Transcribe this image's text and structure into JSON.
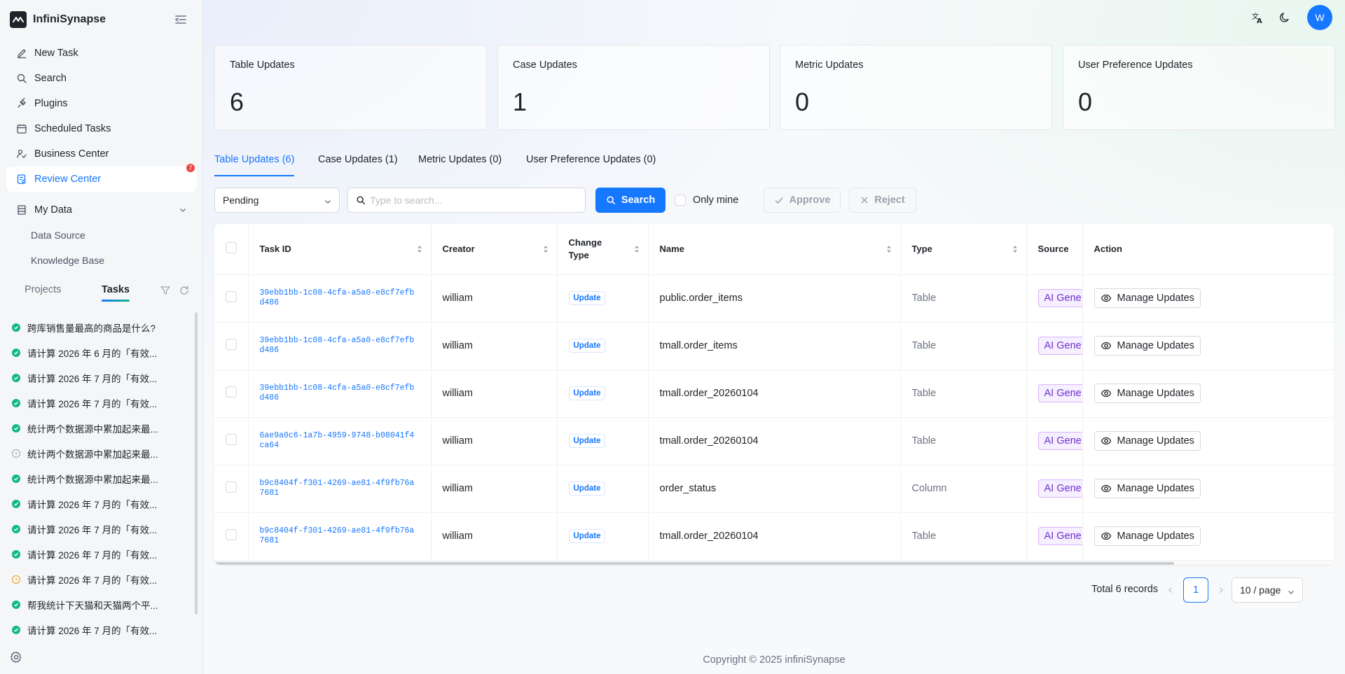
{
  "brand": {
    "name": "InfiniSynapse"
  },
  "nav": {
    "items": [
      {
        "label": "New Task",
        "icon": "edit-icon"
      },
      {
        "label": "Search",
        "icon": "search-icon"
      },
      {
        "label": "Plugins",
        "icon": "plug-icon"
      },
      {
        "label": "Scheduled Tasks",
        "icon": "calendar-icon"
      },
      {
        "label": "Business Center",
        "icon": "business-icon"
      },
      {
        "label": "Review Center",
        "icon": "review-icon",
        "active": true,
        "badge": "7"
      }
    ],
    "my_data": {
      "label": "My Data",
      "children": [
        "Data Source",
        "Knowledge Base"
      ]
    }
  },
  "side_tabs": {
    "projects": "Projects",
    "tasks": "Tasks"
  },
  "tasks": [
    {
      "title": "跨库销售量最高的商品是什么?",
      "status": "ok"
    },
    {
      "title": "请计算 2026 年 6 月的「有效...",
      "status": "ok"
    },
    {
      "title": "请计算 2026 年 7 月的「有效...",
      "status": "ok"
    },
    {
      "title": "请计算 2026 年 7 月的「有效...",
      "status": "ok"
    },
    {
      "title": "统计两个数据源中累加起来最...",
      "status": "ok"
    },
    {
      "title": "统计两个数据源中累加起来最...",
      "status": "pending"
    },
    {
      "title": "统计两个数据源中累加起来最...",
      "status": "ok"
    },
    {
      "title": "请计算 2026 年 7 月的「有效...",
      "status": "ok"
    },
    {
      "title": "请计算 2026 年 7 月的「有效...",
      "status": "ok"
    },
    {
      "title": "请计算 2026 年 7 月的「有效...",
      "status": "ok"
    },
    {
      "title": "请计算 2026 年 7 月的「有效...",
      "status": "warn"
    },
    {
      "title": "帮我统计下天猫和天猫两个平...",
      "status": "ok"
    },
    {
      "title": "请计算 2026 年 7 月的「有效...",
      "status": "ok"
    }
  ],
  "user": {
    "avatar_initial": "W"
  },
  "stats": [
    {
      "label": "Table Updates",
      "value": "6"
    },
    {
      "label": "Case Updates",
      "value": "1"
    },
    {
      "label": "Metric Updates",
      "value": "0"
    },
    {
      "label": "User Preference Updates",
      "value": "0"
    }
  ],
  "tabs": [
    {
      "label": "Table Updates (6)",
      "active": true
    },
    {
      "label": "Case Updates (1)"
    },
    {
      "label": "Metric Updates (0)"
    },
    {
      "label": "User Preference Updates (0)"
    }
  ],
  "toolbar": {
    "status_value": "Pending",
    "search_placeholder": "Type to search...",
    "search_label": "Search",
    "only_mine_label": "Only mine",
    "approve_label": "Approve",
    "reject_label": "Reject"
  },
  "table": {
    "columns": {
      "task_id": "Task ID",
      "creator": "Creator",
      "change_type": "Change Type",
      "name": "Name",
      "type": "Type",
      "source": "Source",
      "action": "Action"
    },
    "rows": [
      {
        "task_id": "39ebb1bb-1c08-4cfa-a5a0-e8cf7efbd486",
        "creator": "william",
        "change_type": "Update",
        "name": "public.order_items",
        "type": "Table",
        "source": "AI Gene",
        "action": "Manage Updates"
      },
      {
        "task_id": "39ebb1bb-1c08-4cfa-a5a0-e8cf7efbd486",
        "creator": "william",
        "change_type": "Update",
        "name": "tmall.order_items",
        "type": "Table",
        "source": "AI Gene",
        "action": "Manage Updates"
      },
      {
        "task_id": "39ebb1bb-1c08-4cfa-a5a0-e8cf7efbd486",
        "creator": "william",
        "change_type": "Update",
        "name": "tmall.order_20260104",
        "type": "Table",
        "source": "AI Gene",
        "action": "Manage Updates"
      },
      {
        "task_id": "6ae9a0c6-1a7b-4959-9748-b08041f4ca64",
        "creator": "william",
        "change_type": "Update",
        "name": "tmall.order_20260104",
        "type": "Table",
        "source": "AI Gene",
        "action": "Manage Updates"
      },
      {
        "task_id": "b9c8404f-f301-4269-ae81-4f9fb76a7681",
        "creator": "william",
        "change_type": "Update",
        "name": "order_status",
        "type": "Column",
        "source": "AI Gene",
        "action": "Manage Updates"
      },
      {
        "task_id": "b9c8404f-f301-4269-ae81-4f9fb76a7681",
        "creator": "william",
        "change_type": "Update",
        "name": "tmall.order_20260104",
        "type": "Table",
        "source": "AI Gene",
        "action": "Manage Updates"
      }
    ]
  },
  "pagination": {
    "total": "Total 6 records",
    "current": "1",
    "page_size": "10 / page"
  },
  "footer": {
    "copyright": "Copyright © 2025 infiniSynapse"
  },
  "colors": {
    "accent": "#1677ff",
    "success": "#10b981",
    "warning": "#f59e0b",
    "danger": "#ef4444",
    "ai_tag": "#722ed1"
  }
}
